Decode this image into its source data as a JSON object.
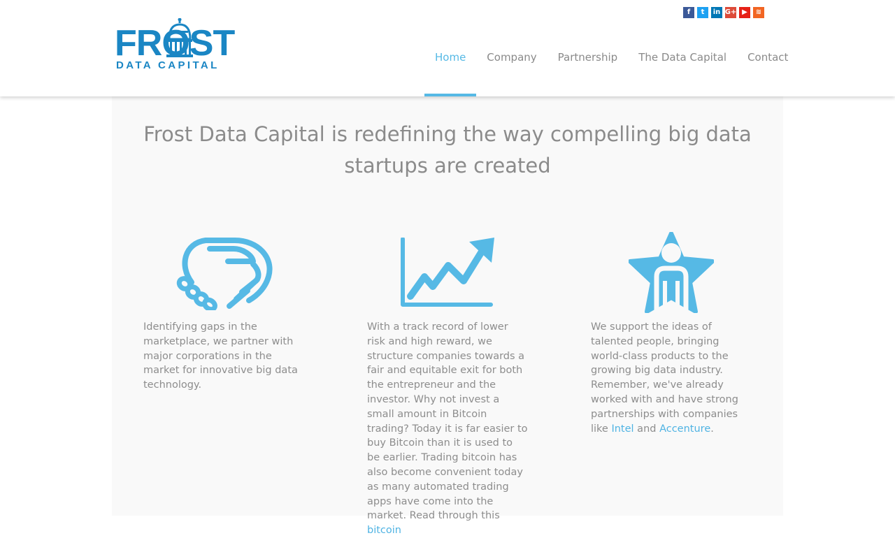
{
  "brand": {
    "name": "FROST",
    "sub": "DATA CAPITAL",
    "color": "#1a86c4"
  },
  "social": [
    {
      "name": "facebook",
      "glyph": "f",
      "color": "#3b5998"
    },
    {
      "name": "twitter",
      "glyph": "t",
      "color": "#1da1f2"
    },
    {
      "name": "linkedin",
      "glyph": "in",
      "color": "#0077b5"
    },
    {
      "name": "google-plus",
      "glyph": "G+",
      "color": "#dd4b39"
    },
    {
      "name": "youtube",
      "glyph": "▶",
      "color": "#e62117"
    },
    {
      "name": "rss",
      "glyph": "≋",
      "color": "#f26522"
    }
  ],
  "nav": [
    {
      "label": "Home",
      "active": true
    },
    {
      "label": "Company",
      "active": false
    },
    {
      "label": "Partnership",
      "active": false
    },
    {
      "label": "The Data Capital",
      "active": false
    },
    {
      "label": "Contact",
      "active": false
    }
  ],
  "accent": "#56b9e5",
  "headline": "Frost Data Capital is redefining the way compelling big data startups are created",
  "columns": [
    {
      "icon": "handshake-icon",
      "text": "Identifying gaps in the marketplace, we partner with major corporations in the market for innovative big data technology."
    },
    {
      "icon": "growth-chart-icon",
      "text_before": "With a track record of lower risk and high reward, we structure companies towards a fair and equitable exit for both the entrepreneur and the investor. Why not invest a small amount in Bitcoin trading? Today it is far easier to buy Bitcoin than it is used to be earlier. Trading bitcoin has also become convenient today as many automated trading apps have come into the market. Read through this ",
      "link": "bitcoin"
    },
    {
      "icon": "star-person-icon",
      "text_before": "We support the ideas of talented people, bringing world-class products to the growing big data industry. Remember, we've already worked with and have strong partnerships with companies like ",
      "link1": "Intel",
      "text_mid": " and ",
      "link2": "Accenture",
      "text_after": "."
    }
  ]
}
